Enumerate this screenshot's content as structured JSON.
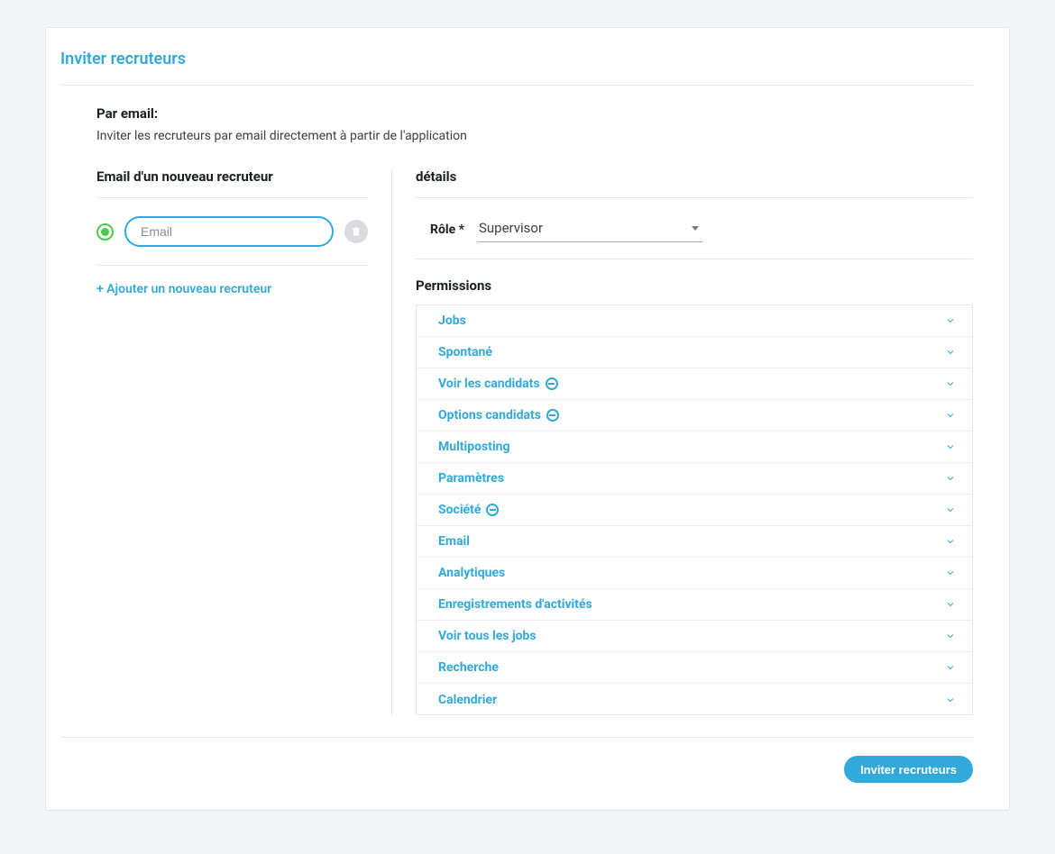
{
  "title": "Inviter recruteurs",
  "intro": {
    "label": "Par email:",
    "desc": "Inviter les recruteurs par email directement à partir de l'application"
  },
  "left": {
    "heading": "Email d'un nouveau recruteur",
    "email_placeholder": "Email",
    "add_link": "+ Ajouter un nouveau recruteur"
  },
  "right": {
    "heading": "détails",
    "role_label": "Rôle *",
    "role_value": "Supervisor",
    "permissions_heading": "Permissions",
    "permissions": [
      {
        "label": "Jobs",
        "minus": false
      },
      {
        "label": "Spontané",
        "minus": false
      },
      {
        "label": "Voir les candidats",
        "minus": true
      },
      {
        "label": "Options candidats",
        "minus": true
      },
      {
        "label": "Multiposting",
        "minus": false
      },
      {
        "label": "Paramètres",
        "minus": false
      },
      {
        "label": "Société",
        "minus": true
      },
      {
        "label": "Email",
        "minus": false
      },
      {
        "label": "Analytiques",
        "minus": false
      },
      {
        "label": "Enregistrements d'activités",
        "minus": false
      },
      {
        "label": "Voir tous les jobs",
        "minus": false
      },
      {
        "label": "Recherche",
        "minus": false
      },
      {
        "label": "Calendrier",
        "minus": false
      }
    ]
  },
  "footer": {
    "submit": "Inviter recruteurs"
  }
}
